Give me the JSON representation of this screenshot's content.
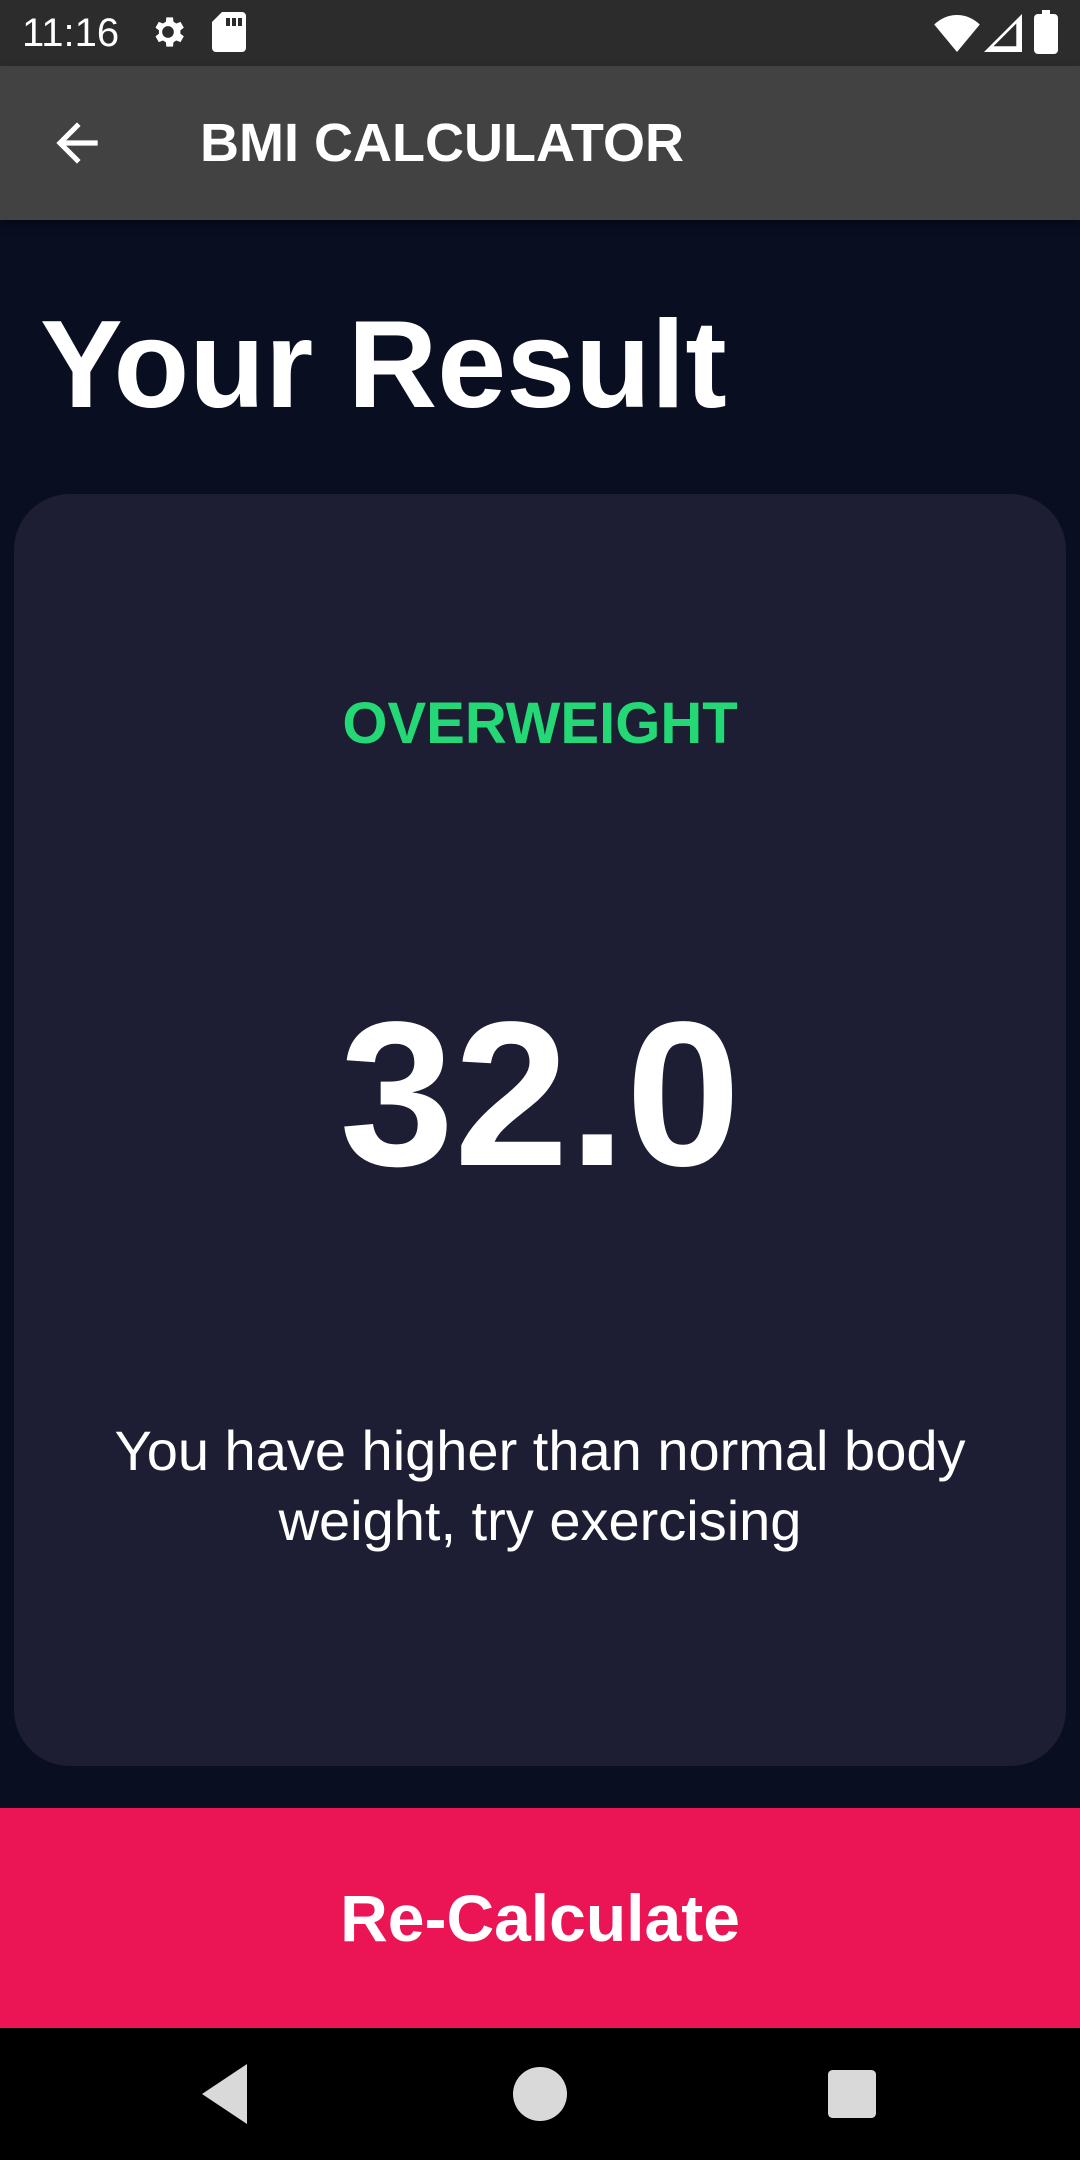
{
  "status_bar": {
    "time": "11:16",
    "icons": [
      "settings-icon",
      "sd-card-icon",
      "wifi-icon",
      "cell-signal-icon",
      "battery-icon"
    ]
  },
  "app_bar": {
    "title": "BMI CALCULATOR",
    "back_icon": "arrow-back-icon"
  },
  "page": {
    "title": "Your Result"
  },
  "result": {
    "category": "OVERWEIGHT",
    "bmi_value": "32.0",
    "message": "You have higher than normal body weight, try exercising"
  },
  "actions": {
    "recalculate_label": "Re-Calculate"
  },
  "nav_bar": {
    "icons": [
      "back-triangle-icon",
      "home-circle-icon",
      "recents-square-icon"
    ]
  },
  "colors": {
    "background": "#0a0e21",
    "card": "#1d1e33",
    "accent_green": "#24d876",
    "button_pink": "#eb1555",
    "app_bar": "#424242",
    "status_bar": "#2c2c2c"
  }
}
